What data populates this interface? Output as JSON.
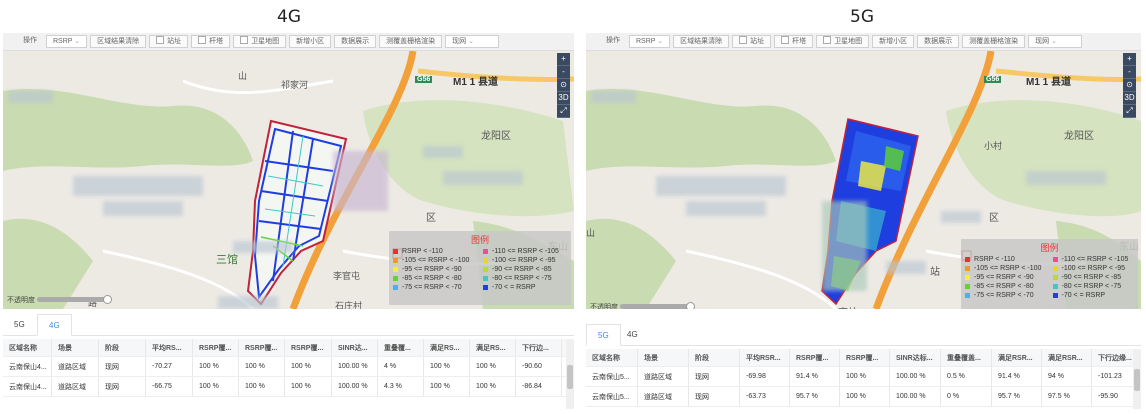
{
  "titles": {
    "left": "4G",
    "right": "5G"
  },
  "toolbar": {
    "op": "操作",
    "metric": "RSRP",
    "clear": "区域结果清除",
    "site": "站址",
    "tower": "杆塔",
    "satellite": "卫星地图",
    "new_cell": "新增小区",
    "data_show": "数据展示",
    "grid_render": "测覆盖栅格渲染",
    "stage": "现网"
  },
  "map": {
    "labels_left": {
      "g56": "G56",
      "m1": "M1 1 县道",
      "qijia": "祁家河",
      "longyang": "龙阳区",
      "sanguan": "三馆",
      "liguan": "李官屯",
      "dongshan": "东山",
      "shizhuang": "石庄村",
      "road": "路",
      "shan": "山",
      "xq": "区"
    },
    "labels_right": {
      "g56": "G56",
      "m1": "M1 1 县道",
      "xiaocun": "小村",
      "longyang": "龙阳区",
      "station": "站",
      "nanzhan": "南站",
      "dongshan": "东山",
      "xq": "区",
      "shan": "山"
    },
    "controls": [
      "+",
      "-",
      "⊙",
      "3D",
      "⤢"
    ]
  },
  "legend": {
    "title": "图例",
    "items": [
      {
        "label": "RSRP < -110",
        "color": "#e8322d"
      },
      {
        "label": "-110 <= RSRP < -105",
        "color": "#e8509a"
      },
      {
        "label": "-105 <= RSRP < -100",
        "color": "#f39a1f"
      },
      {
        "label": "-100 <= RSRP < -95",
        "color": "#e8d62a"
      },
      {
        "label": "-95 <= RSRP < -90",
        "color": "#f6f03b"
      },
      {
        "label": "-90 <= RSRP < -85",
        "color": "#b8dc2e"
      },
      {
        "label": "-85 <= RSRP < -80",
        "color": "#5ed62e"
      },
      {
        "label": "-80 <= RSRP < -75",
        "color": "#3ec9c9"
      },
      {
        "label": "-75 <= RSRP < -70",
        "color": "#4bb0f0"
      },
      {
        "label": "-70 < = RSRP",
        "color": "#1f3ee0"
      }
    ]
  },
  "opacity_label": "不透明度",
  "left_panel": {
    "tabs": [
      "5G",
      "4G"
    ],
    "headers": [
      "区域名称",
      "场景",
      "阶段",
      "平均RS...",
      "RSRP覆...",
      "RSRP覆...",
      "RSRP覆...",
      "SINR达...",
      "重叠覆...",
      "满足RS...",
      "满足RS...",
      "下行边..."
    ],
    "rows": [
      [
        "云南保山4...",
        "道路区域",
        "现网",
        "-70.27",
        "100 %",
        "100 %",
        "100 %",
        "100.00 %",
        "4 %",
        "100 %",
        "100 %",
        "-90.60"
      ],
      [
        "云南保山4...",
        "道路区域",
        "现网",
        "-66.75",
        "100 %",
        "100 %",
        "100 %",
        "100.00 %",
        "4.3 %",
        "100 %",
        "100 %",
        "-86.84"
      ]
    ]
  },
  "right_panel": {
    "tabs": [
      "5G",
      "4G"
    ],
    "headers": [
      "区域名称",
      "场景",
      "阶段",
      "平均RSR...",
      "RSRP覆...",
      "RSRP覆...",
      "SINR达标...",
      "重叠覆盖...",
      "满足RSR...",
      "满足RSR...",
      "下行边缘..."
    ],
    "rows": [
      [
        "云南保山5...",
        "道路区域",
        "现网",
        "-69.98",
        "91.4 %",
        "100 %",
        "100.00 %",
        "0.5 %",
        "91.4 %",
        "94 %",
        "-101.23"
      ],
      [
        "云南保山5...",
        "道路区域",
        "现网",
        "-63.73",
        "95.7 %",
        "100 %",
        "100.00 %",
        "0 %",
        "95.7 %",
        "97.5 %",
        "-95.90"
      ]
    ]
  }
}
